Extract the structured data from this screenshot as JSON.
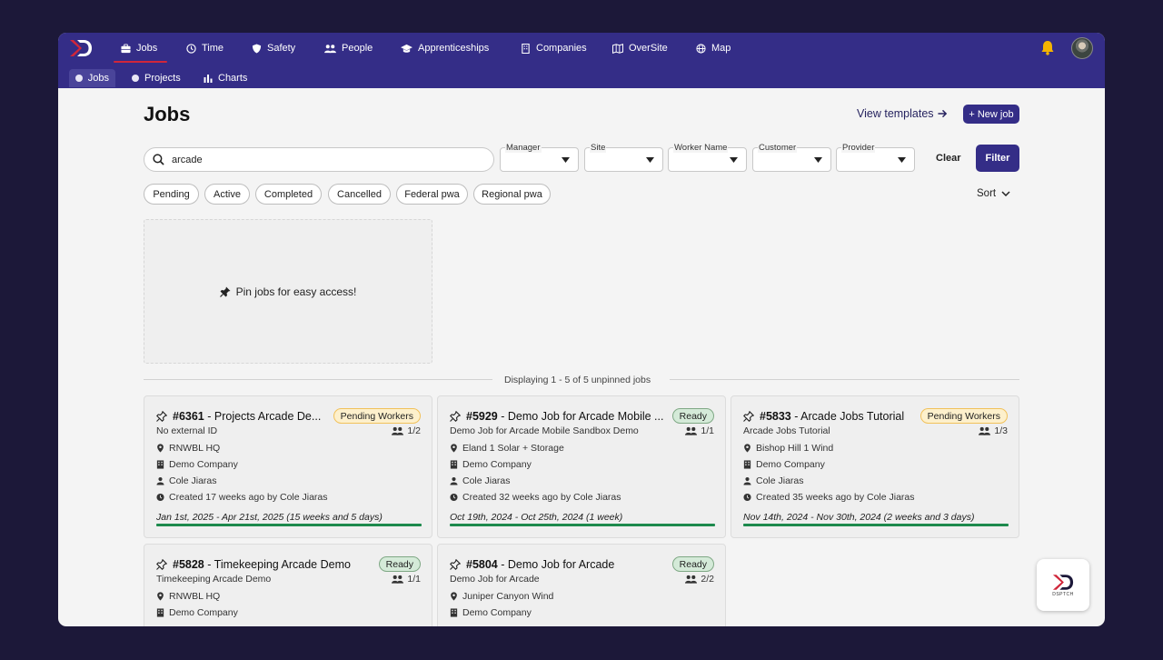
{
  "nav": {
    "items": [
      {
        "label": "Jobs",
        "icon": "briefcase-icon"
      },
      {
        "label": "Time",
        "icon": "clock-icon"
      },
      {
        "label": "Safety",
        "icon": "shield-icon"
      },
      {
        "label": "People",
        "icon": "people-icon"
      },
      {
        "label": "Apprenticeships",
        "icon": "graduation-cap-icon"
      },
      {
        "label": "Companies",
        "icon": "building-icon"
      },
      {
        "label": "OverSite",
        "icon": "map-book-icon"
      },
      {
        "label": "Map",
        "icon": "globe-icon"
      }
    ],
    "active": "Jobs"
  },
  "subnav": {
    "items": [
      {
        "label": "Jobs"
      },
      {
        "label": "Projects"
      },
      {
        "label": "Charts"
      }
    ],
    "active": "Jobs"
  },
  "header": {
    "title": "Jobs",
    "view_templates": "View templates",
    "new_job": "+ New job"
  },
  "filters": {
    "search_value": "arcade",
    "selects": [
      {
        "label": "Manager"
      },
      {
        "label": "Site"
      },
      {
        "label": "Worker Name"
      },
      {
        "label": "Customer"
      },
      {
        "label": "Provider"
      }
    ],
    "clear": "Clear",
    "filter": "Filter",
    "chips": [
      "Pending",
      "Active",
      "Completed",
      "Cancelled",
      "Federal pwa",
      "Regional pwa"
    ],
    "sort": "Sort"
  },
  "pin_box": {
    "text": "Pin jobs for easy access!"
  },
  "divider": {
    "text": "Displaying 1 - 5 of 5 unpinned jobs"
  },
  "cards": [
    {
      "title": "#6361",
      "title_rest": " - Projects Arcade De...",
      "status": "Pending Workers",
      "subtitle": "No external ID",
      "workers": "1/2",
      "site": "RNWBL HQ",
      "company": "Demo Company",
      "manager": "Cole Jiaras",
      "created": "Created 17 weeks ago by Cole Jiaras",
      "dates": "Jan 1st, 2025 - Apr 21st, 2025 (15 weeks and 5 days)"
    },
    {
      "title": "#5929",
      "title_rest": " - Demo Job for Arcade Mobile ...",
      "status": "Ready",
      "subtitle": "Demo Job for Arcade Mobile Sandbox Demo",
      "workers": "1/1",
      "site": "Eland 1 Solar + Storage",
      "company": "Demo Company",
      "manager": "Cole Jiaras",
      "created": "Created 32 weeks ago by Cole Jiaras",
      "dates": "Oct 19th, 2024 - Oct 25th, 2024 (1 week)"
    },
    {
      "title": "#5833",
      "title_rest": " - Arcade Jobs Tutorial",
      "status": "Pending Workers",
      "subtitle": "Arcade Jobs Tutorial",
      "workers": "1/3",
      "site": "Bishop Hill 1 Wind",
      "company": "Demo Company",
      "manager": "Cole Jiaras",
      "created": "Created 35 weeks ago by Cole Jiaras",
      "dates": "Nov 14th, 2024 - Nov 30th, 2024 (2 weeks and 3 days)"
    },
    {
      "title": "#5828",
      "title_rest": " - Timekeeping Arcade Demo",
      "status": "Ready",
      "subtitle": "Timekeeping Arcade Demo",
      "workers": "1/1",
      "site": "RNWBL HQ",
      "company": "Demo Company"
    },
    {
      "title": "#5804",
      "title_rest": " - Demo Job for Arcade",
      "status": "Ready",
      "subtitle": "Demo Job for Arcade",
      "workers": "2/2",
      "site": "Juniper Canyon Wind",
      "company": "Demo Company"
    }
  ],
  "fab": {
    "label": "DSPTCH"
  },
  "colors": {
    "brand": "#342d87",
    "background": "#1c1839",
    "ready": "#d4ead8",
    "pending": "#fdf0cc",
    "progress": "#1d8a4d",
    "accent_underline": "#d0263a"
  }
}
